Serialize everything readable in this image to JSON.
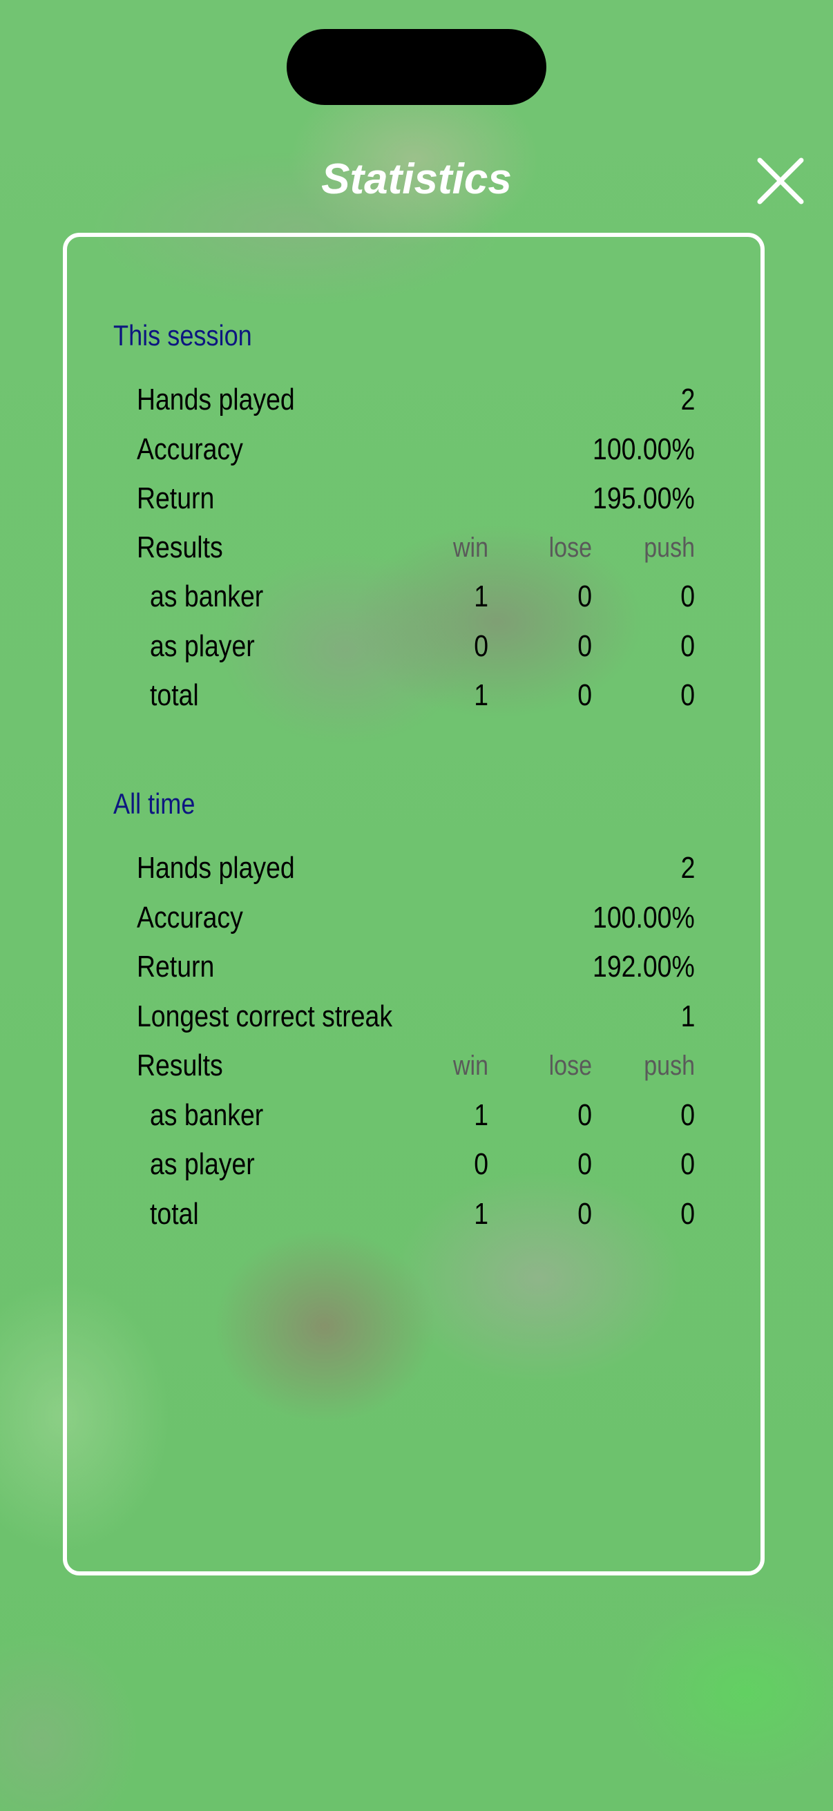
{
  "header": {
    "title": "Statistics",
    "close_icon": "close-icon"
  },
  "session": {
    "title": "This session",
    "rows": [
      {
        "label": "Hands played",
        "value": "2"
      },
      {
        "label": "Accuracy",
        "value": "100.00%"
      },
      {
        "label": "Return",
        "value": "195.00%"
      }
    ],
    "results": {
      "label": "Results",
      "headers": {
        "win": "win",
        "lose": "lose",
        "push": "push"
      },
      "rows": [
        {
          "label": "as banker",
          "win": "1",
          "lose": "0",
          "push": "0"
        },
        {
          "label": "as player",
          "win": "0",
          "lose": "0",
          "push": "0"
        },
        {
          "label": "total",
          "win": "1",
          "lose": "0",
          "push": "0"
        }
      ]
    }
  },
  "alltime": {
    "title": "All time",
    "rows": [
      {
        "label": "Hands played",
        "value": "2"
      },
      {
        "label": "Accuracy",
        "value": "100.00%"
      },
      {
        "label": "Return",
        "value": "192.00%"
      },
      {
        "label": "Longest correct streak",
        "value": "1"
      }
    ],
    "results": {
      "label": "Results",
      "headers": {
        "win": "win",
        "lose": "lose",
        "push": "push"
      },
      "rows": [
        {
          "label": "as banker",
          "win": "1",
          "lose": "0",
          "push": "0"
        },
        {
          "label": "as player",
          "win": "0",
          "lose": "0",
          "push": "0"
        },
        {
          "label": "total",
          "win": "1",
          "lose": "0",
          "push": "0"
        }
      ]
    }
  },
  "colors": {
    "section_title": "#0d1680",
    "header_gray": "#5a5a5a",
    "text": "#000000"
  }
}
